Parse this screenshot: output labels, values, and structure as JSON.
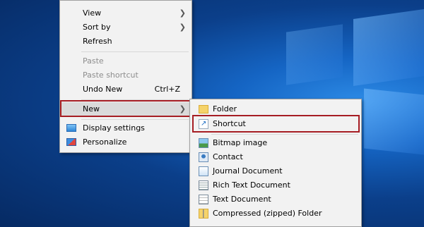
{
  "context_menu": {
    "items": [
      {
        "label": "View",
        "submenu": true
      },
      {
        "label": "Sort by",
        "submenu": true
      },
      {
        "label": "Refresh"
      },
      {
        "label": "Paste",
        "disabled": true
      },
      {
        "label": "Paste shortcut",
        "disabled": true
      },
      {
        "label": "Undo New",
        "shortcut": "Ctrl+Z"
      },
      {
        "label": "New",
        "submenu": true,
        "highlighted": true
      },
      {
        "label": "Display settings",
        "icon": "display-settings-icon"
      },
      {
        "label": "Personalize",
        "icon": "personalize-icon"
      }
    ]
  },
  "new_submenu": {
    "items": [
      {
        "label": "Folder",
        "icon": "folder-icon"
      },
      {
        "label": "Shortcut",
        "icon": "shortcut-icon",
        "highlighted": true
      },
      {
        "label": "Bitmap image",
        "icon": "bitmap-image-icon"
      },
      {
        "label": "Contact",
        "icon": "contact-icon"
      },
      {
        "label": "Journal Document",
        "icon": "journal-document-icon"
      },
      {
        "label": "Rich Text Document",
        "icon": "rich-text-document-icon"
      },
      {
        "label": "Text Document",
        "icon": "text-document-icon"
      },
      {
        "label": "Compressed (zipped) Folder",
        "icon": "zip-folder-icon"
      }
    ]
  },
  "colors": {
    "highlight_border": "#a61d23",
    "menu_bg": "#f2f2f2",
    "desktop": "#0b3f8a"
  }
}
